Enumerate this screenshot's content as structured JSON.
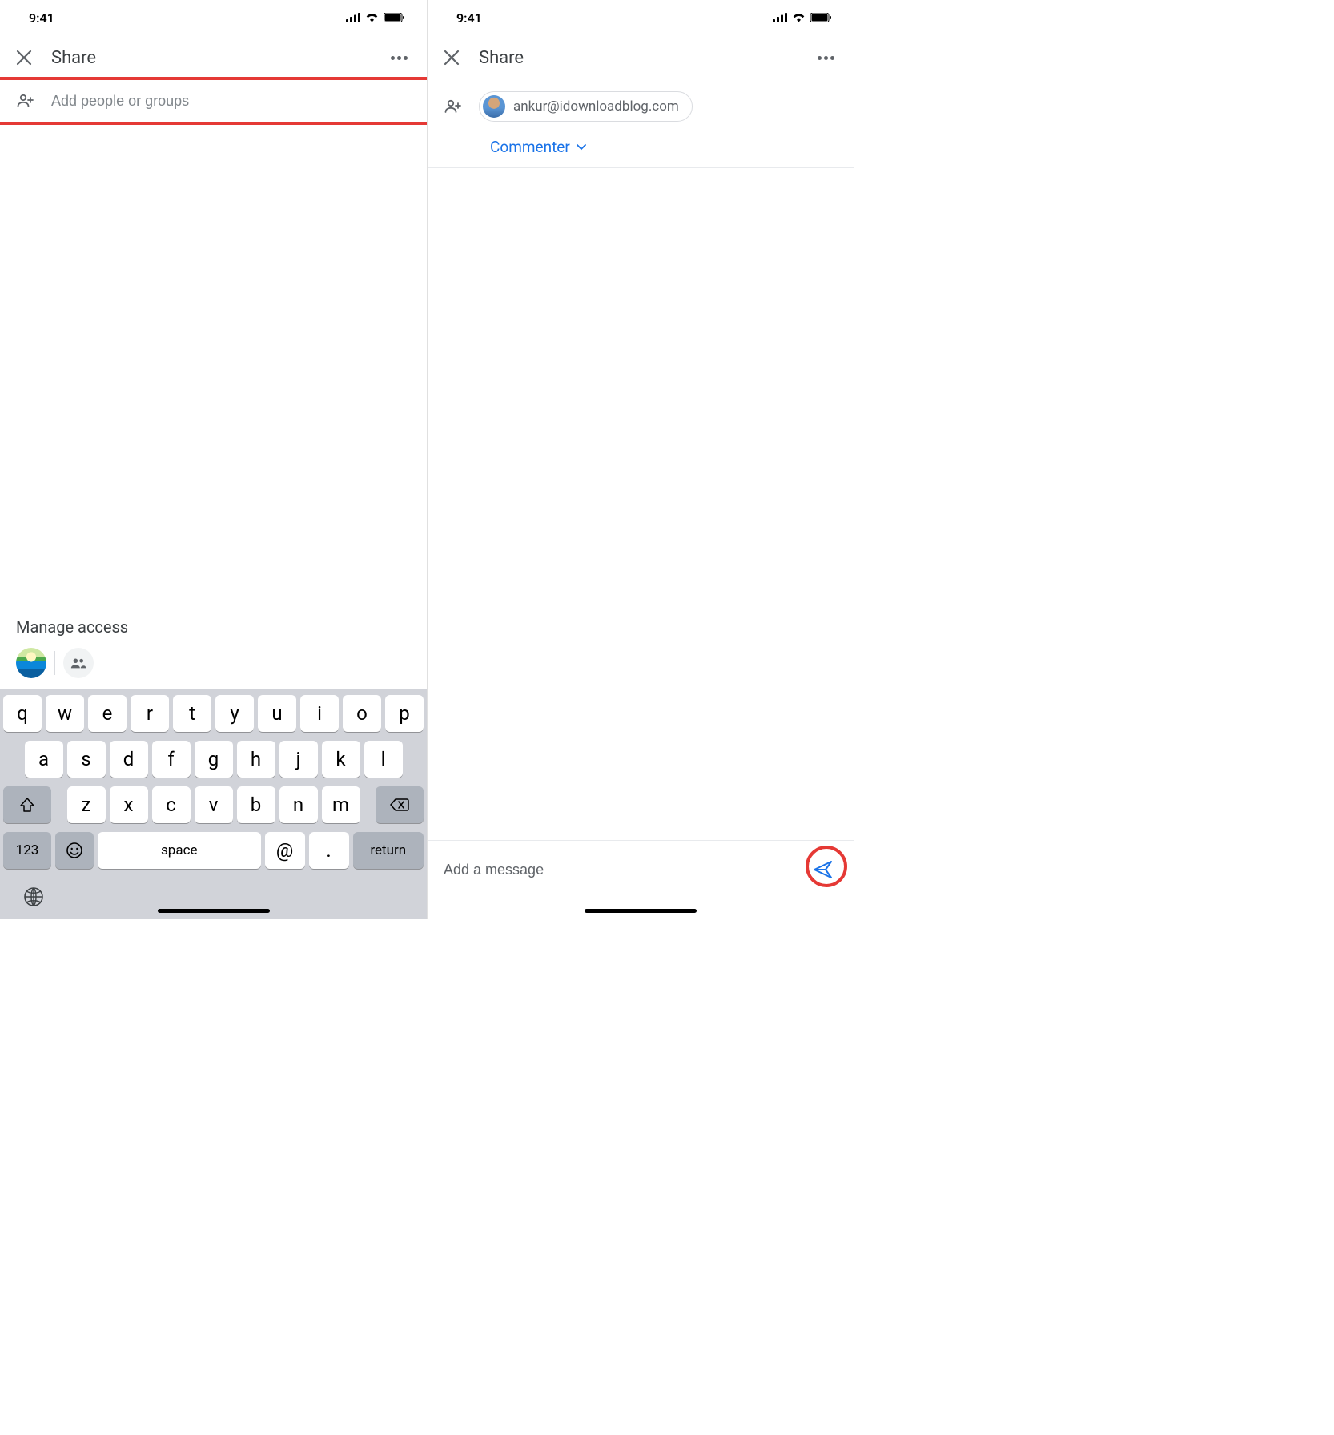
{
  "left": {
    "status_time": "9:41",
    "title": "Share",
    "input_placeholder": "Add people or groups",
    "manage_label": "Manage access",
    "keyboard": {
      "row1": [
        "q",
        "w",
        "e",
        "r",
        "t",
        "y",
        "u",
        "i",
        "o",
        "p"
      ],
      "row2": [
        "a",
        "s",
        "d",
        "f",
        "g",
        "h",
        "j",
        "k",
        "l"
      ],
      "row3": [
        "z",
        "x",
        "c",
        "v",
        "b",
        "n",
        "m"
      ],
      "num_label": "123",
      "space_label": "space",
      "at_label": "@",
      "dot_label": ".",
      "return_label": "return"
    }
  },
  "right": {
    "status_time": "9:41",
    "title": "Share",
    "chip_email": "ankur@idownloadblog.com",
    "role_label": "Commenter",
    "message_placeholder": "Add a message"
  }
}
